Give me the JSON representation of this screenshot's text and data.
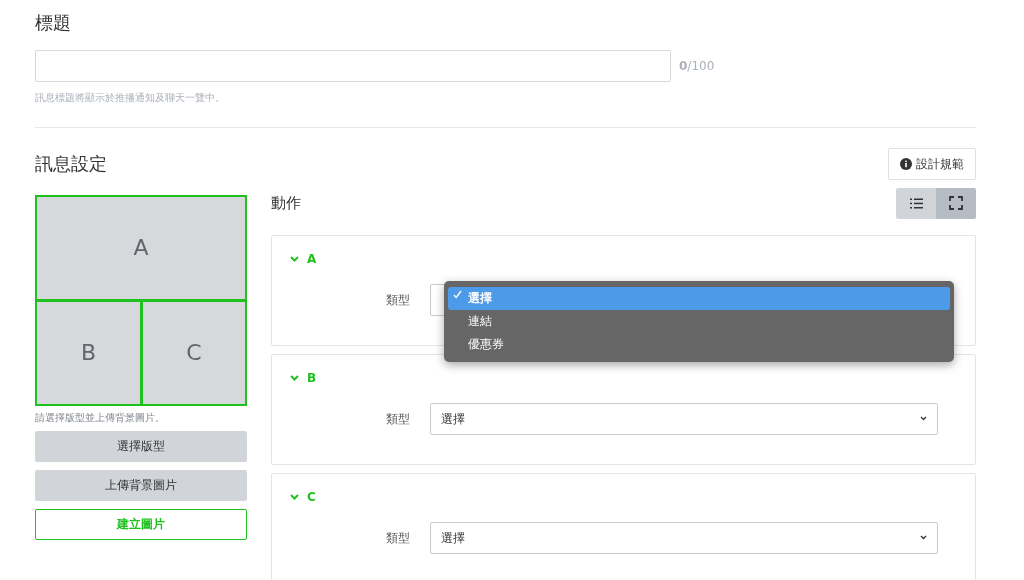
{
  "title_section": {
    "heading": "標題",
    "counter": "**0**/100",
    "hint": "訊息標題將顯示於推播通知及聊天一覽中。"
  },
  "message_settings": {
    "heading": "訊息設定",
    "guide_button": "設計規範",
    "layout_preview": {
      "hint": "請選擇版型並上傳背景圖片。",
      "areas": [
        "A",
        "B",
        "C"
      ]
    },
    "buttons": [
      {
        "label": "選擇版型",
        "kind": "secondary"
      },
      {
        "label": "上傳背景圖片",
        "kind": "secondary"
      },
      {
        "label": "建立圖片",
        "kind": "outline"
      }
    ],
    "actions_heading": "動作",
    "view_toggle": [
      {
        "kind": "list",
        "selected": false
      },
      {
        "kind": "fullscreen",
        "selected": true
      }
    ],
    "actions": [
      {
        "label": "A",
        "expanded": true,
        "type_label": "類型",
        "select": {
          "open": true,
          "options": [
            {
              "label": "選擇",
              "selected": true
            },
            {
              "label": "連結",
              "selected": false
            },
            {
              "label": "優惠券",
              "selected": false
            }
          ]
        }
      },
      {
        "label": "B",
        "expanded": true,
        "type_label": "類型",
        "select": {
          "open": false,
          "value": "選擇"
        }
      },
      {
        "label": "C",
        "expanded": true,
        "type_label": "類型",
        "select": {
          "open": false,
          "value": "選擇"
        }
      }
    ]
  }
}
